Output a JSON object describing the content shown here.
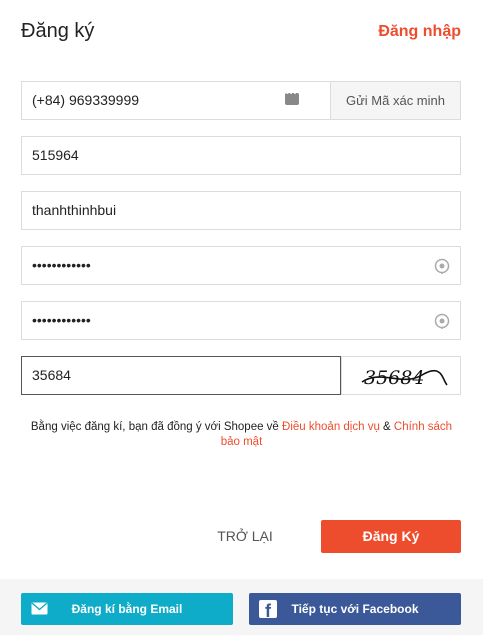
{
  "header": {
    "title": "Đăng ký",
    "login_label": "Đăng nhập"
  },
  "form": {
    "phone_value": "(+84) 969339999",
    "send_code_label": "Gửi Mã xác minh",
    "otp_value": "515964",
    "username_value": "thanhthinhbui",
    "password_value": "••••••••••••",
    "confirm_password_value": "••••••••••••",
    "captcha_value": "35684",
    "captcha_image_text": "35684"
  },
  "terms": {
    "prefix": "Bằng việc đăng kí, bạn đã đồng ý với Shopee về ",
    "tos_link": "Điều khoản dịch vụ",
    "joiner": " & ",
    "privacy_link": "Chính sách bảo mật"
  },
  "actions": {
    "back_label": "TRỞ LẠI",
    "register_label": "Đăng Ký"
  },
  "social": {
    "email_label": "Đăng kí bằng Email",
    "facebook_label": "Tiếp tục với Facebook"
  },
  "colors": {
    "accent": "#ee4d2d",
    "email": "#0eacc9",
    "facebook": "#3b5999"
  }
}
